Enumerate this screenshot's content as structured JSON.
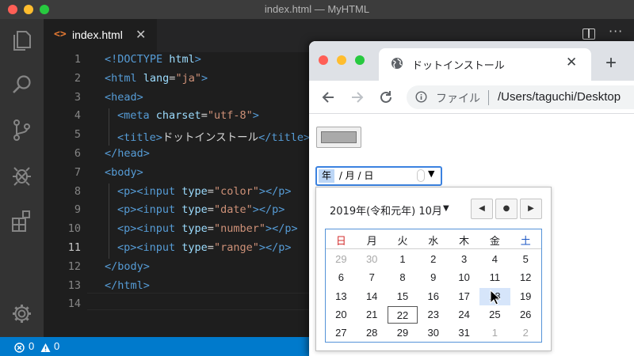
{
  "window": {
    "title": "index.html — MyHTML"
  },
  "activity_bar": [
    "files-icon",
    "search-icon",
    "source-control-icon",
    "debug-icon",
    "extensions-icon",
    "settings-gear-icon"
  ],
  "editor": {
    "tab": {
      "icon": "<>",
      "label": "index.html",
      "close": "✕"
    },
    "line_numbers": [
      "1",
      "2",
      "3",
      "4",
      "5",
      "6",
      "7",
      "8",
      "9",
      "10",
      "11",
      "12",
      "13",
      "14"
    ],
    "active_line": "11",
    "lines": [
      [
        {
          "t": "tag",
          "v": "<!DOCTYPE "
        },
        {
          "t": "attr",
          "v": "html"
        },
        {
          "t": "tag",
          "v": ">"
        }
      ],
      [
        {
          "t": "tag",
          "v": "<html "
        },
        {
          "t": "attr",
          "v": "lang"
        },
        {
          "t": "txt",
          "v": "="
        },
        {
          "t": "str",
          "v": "\"ja\""
        },
        {
          "t": "tag",
          "v": ">"
        }
      ],
      [
        {
          "t": "tag",
          "v": "<head>"
        }
      ],
      [
        {
          "t": "tag",
          "v": "<meta "
        },
        {
          "t": "attr",
          "v": "charset"
        },
        {
          "t": "txt",
          "v": "="
        },
        {
          "t": "str",
          "v": "\"utf-8\""
        },
        {
          "t": "tag",
          "v": ">"
        }
      ],
      [
        {
          "t": "tag",
          "v": "<title>"
        },
        {
          "t": "txt",
          "v": "ドットインストール"
        },
        {
          "t": "tag",
          "v": "</title>"
        }
      ],
      [
        {
          "t": "tag",
          "v": "</head>"
        }
      ],
      [
        {
          "t": "tag",
          "v": "<body>"
        }
      ],
      [
        {
          "t": "tag",
          "v": "<p><input "
        },
        {
          "t": "attr",
          "v": "type"
        },
        {
          "t": "txt",
          "v": "="
        },
        {
          "t": "str",
          "v": "\"color\""
        },
        {
          "t": "tag",
          "v": "></p>"
        }
      ],
      [
        {
          "t": "tag",
          "v": "<p><input "
        },
        {
          "t": "attr",
          "v": "type"
        },
        {
          "t": "txt",
          "v": "="
        },
        {
          "t": "str",
          "v": "\"date\""
        },
        {
          "t": "tag",
          "v": "></p>"
        }
      ],
      [
        {
          "t": "tag",
          "v": "<p><input "
        },
        {
          "t": "attr",
          "v": "type"
        },
        {
          "t": "txt",
          "v": "="
        },
        {
          "t": "str",
          "v": "\"number\""
        },
        {
          "t": "tag",
          "v": "></p>"
        }
      ],
      [
        {
          "t": "tag",
          "v": "<p><input "
        },
        {
          "t": "attr",
          "v": "type"
        },
        {
          "t": "txt",
          "v": "="
        },
        {
          "t": "str",
          "v": "\"range\""
        },
        {
          "t": "tag",
          "v": "></p>"
        }
      ],
      [
        {
          "t": "tag",
          "v": "</body>"
        }
      ],
      [
        {
          "t": "tag",
          "v": "</html>"
        }
      ],
      []
    ]
  },
  "status_bar": {
    "errors": "0",
    "warnings": "0"
  },
  "browser": {
    "tab_title": "ドットインストール",
    "tab_close": "✕",
    "new_tab": "+",
    "file_label": "ファイル",
    "url": "/Users/taguchi/Desktop",
    "color_value": "#aaaaaa",
    "date_input": {
      "year": "年",
      "rest": " / 月 / 日",
      "dropdown": "▼"
    },
    "picker": {
      "month_label": "2019年(令和元年) 10月",
      "month_caret": "▼",
      "prev": "◀",
      "today": "●",
      "next": "▶",
      "weekdays": [
        "日",
        "月",
        "火",
        "水",
        "木",
        "金",
        "土"
      ],
      "weekday_colors": [
        "#d32f2f",
        "#202124",
        "#202124",
        "#202124",
        "#202124",
        "#202124",
        "#1a56c4"
      ],
      "days": [
        [
          "29",
          "30",
          "1",
          "2",
          "3",
          "4",
          "5"
        ],
        [
          "6",
          "7",
          "8",
          "9",
          "10",
          "11",
          "12"
        ],
        [
          "13",
          "14",
          "15",
          "16",
          "17",
          "18",
          "19"
        ],
        [
          "20",
          "21",
          "22",
          "23",
          "24",
          "25",
          "26"
        ],
        [
          "27",
          "28",
          "29",
          "30",
          "31",
          "1",
          "2"
        ]
      ],
      "other_month": [
        [
          0,
          0
        ],
        [
          0,
          1
        ],
        [
          4,
          5
        ],
        [
          4,
          6
        ]
      ],
      "selected": [
        2,
        5
      ],
      "today_cell": [
        3,
        2
      ]
    }
  }
}
